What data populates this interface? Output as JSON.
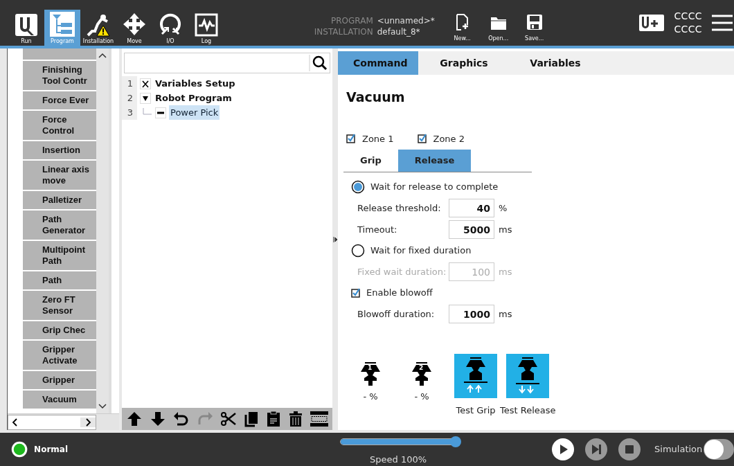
{
  "top_nav": [
    {
      "label": "Run",
      "kind": "logo",
      "selected": false
    },
    {
      "label": "Program",
      "kind": "program",
      "selected": true
    },
    {
      "label": "Installation",
      "kind": "installation",
      "selected": false
    },
    {
      "label": "Move",
      "kind": "move",
      "selected": false
    },
    {
      "label": "I/O",
      "kind": "io",
      "selected": false
    },
    {
      "label": "Log",
      "kind": "log",
      "selected": false
    }
  ],
  "file_info": {
    "program_label": "PROGRAM",
    "program_value": "<unnamed>*",
    "installation_label": "INSTALLATION",
    "installation_value": "default_8*"
  },
  "file_buttons": [
    {
      "label": "New...",
      "kind": "new"
    },
    {
      "label": "Open...",
      "kind": "open"
    },
    {
      "label": "Save...",
      "kind": "save"
    }
  ],
  "user": [
    "CCCC",
    "CCCC"
  ],
  "node_list": [
    "Finishing Tool Contr",
    "Force Ever",
    "Force Control",
    "Insertion",
    "Linear axis move",
    "Palletizer",
    "Path Generator",
    "Multipoint Path",
    "Path",
    "Zero FT Sensor",
    "Grip Chec",
    "Gripper Activate",
    "Gripper",
    "Vacuum"
  ],
  "tree": [
    {
      "line": "1",
      "kind": "variables",
      "label": "Variables Setup",
      "selected": false
    },
    {
      "line": "2",
      "kind": "folder",
      "label": "Robot Program",
      "selected": false,
      "expanded": true,
      "children": [
        {
          "line": "3",
          "kind": "node",
          "label": "Power Pick",
          "selected": true
        }
      ]
    }
  ],
  "tabs": [
    {
      "label": "Command",
      "selected": true
    },
    {
      "label": "Graphics",
      "selected": false
    },
    {
      "label": "Variables",
      "selected": false
    }
  ],
  "command": {
    "title": "Vacuum",
    "zones": [
      {
        "label": "Zone 1",
        "checked": true
      },
      {
        "label": "Zone 2",
        "checked": true
      }
    ],
    "subtabs": [
      {
        "label": "Grip",
        "selected": false
      },
      {
        "label": "Release",
        "selected": true
      }
    ],
    "options": [
      {
        "kind": "radio",
        "label": "Wait for release to complete",
        "selected": true,
        "fields": [
          {
            "label": "Release threshold:",
            "value": "40",
            "unit": "%",
            "disabled": false
          },
          {
            "label": "Timeout:",
            "value": "5000",
            "unit": "ms",
            "disabled": false
          }
        ]
      },
      {
        "kind": "radio",
        "label": "Wait for fixed duration",
        "selected": false,
        "fields": [
          {
            "label": "Fixed wait duration:",
            "value": "100",
            "unit": "ms",
            "disabled": true
          }
        ]
      },
      {
        "kind": "checkbox",
        "label": "Enable blowoff",
        "checked": true,
        "fields": [
          {
            "label": "Blowoff duration:",
            "value": "1000",
            "unit": "ms",
            "disabled": false
          }
        ]
      }
    ],
    "gauges": [
      {
        "number": "1",
        "reading": "- %"
      },
      {
        "number": "2",
        "reading": "- %"
      }
    ],
    "tests": [
      {
        "label": "Test Grip",
        "kind": "grip"
      },
      {
        "label": "Test Release",
        "kind": "release"
      }
    ]
  },
  "status": {
    "label": "Normal",
    "speed_label": "Speed 100%",
    "speed": {
      "level": 1.0
    },
    "simulation_label": "Simulation",
    "simulation": false
  }
}
